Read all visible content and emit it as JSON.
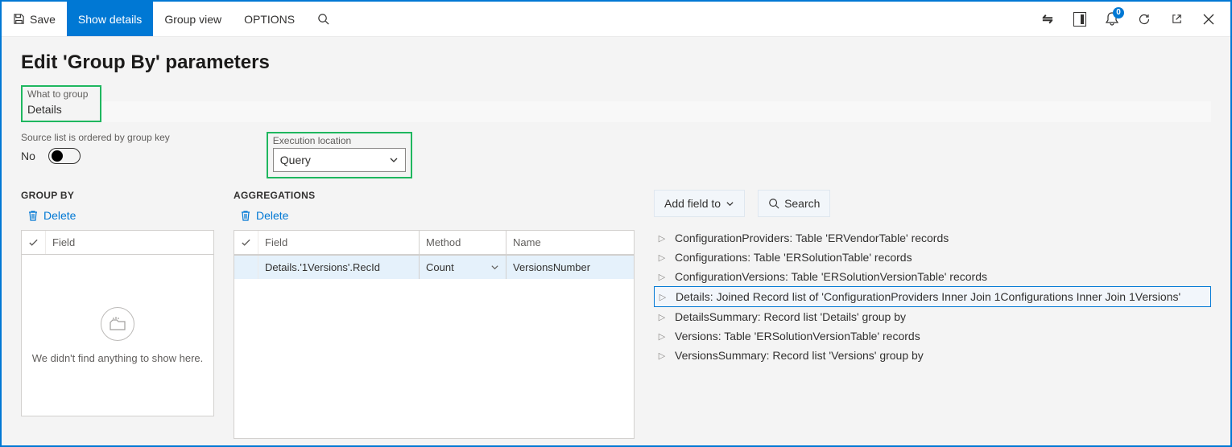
{
  "toolbar": {
    "save": "Save",
    "show_details": "Show details",
    "group_view": "Group view",
    "options": "OPTIONS"
  },
  "notification_count": "0",
  "title": "Edit 'Group By' parameters",
  "what_to_group": {
    "label": "What to group",
    "value": "Details"
  },
  "ordered_by_key": {
    "label": "Source list is ordered by group key",
    "value": "No"
  },
  "execution_location": {
    "label": "Execution location",
    "value": "Query"
  },
  "groupby": {
    "header": "GROUP BY",
    "delete": "Delete",
    "col_field": "Field",
    "empty_msg": "We didn't find anything to show here."
  },
  "aggregations": {
    "header": "AGGREGATIONS",
    "delete": "Delete",
    "col_field": "Field",
    "col_method": "Method",
    "col_name": "Name",
    "row": {
      "field": "Details.'1Versions'.RecId",
      "method": "Count",
      "name": "VersionsNumber"
    }
  },
  "right": {
    "add_field": "Add field to",
    "search": "Search"
  },
  "tree": [
    "ConfigurationProviders: Table 'ERVendorTable' records",
    "Configurations: Table 'ERSolutionTable' records",
    "ConfigurationVersions: Table 'ERSolutionVersionTable' records",
    "Details: Joined Record list of 'ConfigurationProviders Inner Join 1Configurations Inner Join 1Versions'",
    "DetailsSummary: Record list 'Details' group by",
    "Versions: Table 'ERSolutionVersionTable' records",
    "VersionsSummary: Record list 'Versions' group by"
  ]
}
